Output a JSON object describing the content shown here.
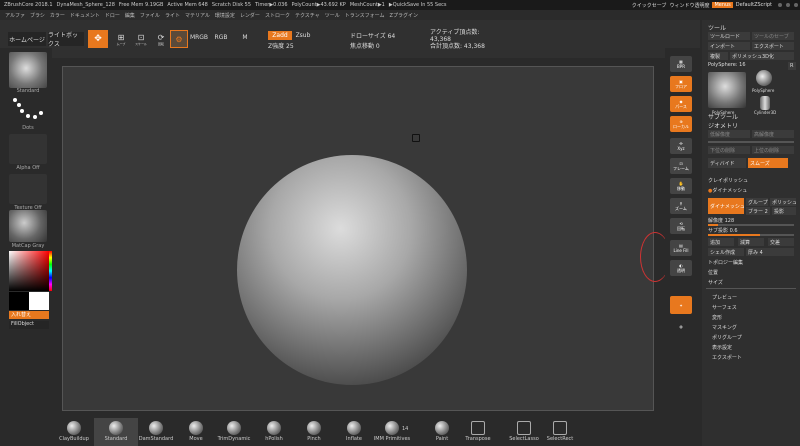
{
  "titlebar": {
    "app": "ZBrushCore 2018.1",
    "doc": "DynaMesh_Sphere_128",
    "mem": "Free Mem 9.19GB",
    "active": "Active Mem 648",
    "scratch": "Scratch Disk 55",
    "timer": "Timer▶0.036",
    "poly": "PolyCount▶43.692 KP",
    "mesh": "MeshCount▶1",
    "quick": "▶QuickSave In 55 Secs"
  },
  "topright": {
    "quicksave": "クイックセーブ",
    "transparent": "ウィンドウ透明度",
    "menus": "Menus",
    "script": "DefaultZScript"
  },
  "menubar": [
    "アルファ",
    "ブラシ",
    "カラー",
    "ドキュメント",
    "ドロー",
    "編集",
    "ファイル",
    "ライト",
    "マテリアル",
    "環境設定",
    "レンダー",
    "ストローク",
    "テクスチャ",
    "ツール",
    "トランスフォーム",
    "Zプラグイン"
  ],
  "toolbar": {
    "home": "ホームページ",
    "lightbox": "ライトボックス",
    "edit": "編集",
    "move": "ムーブ",
    "scale": "スケール",
    "rotate": "回転",
    "mrgb": "MRGB",
    "rgb": "RGB",
    "m": "M",
    "zadd": "Zadd",
    "zsub": "Zsub",
    "zintensity": "Z強度 25",
    "drawsize": "ドローサイズ 64",
    "focal": "焦点移動 0",
    "active_pts": "アクティブ頂点数: 43,368",
    "total_pts": "合計頂点数: 43,368"
  },
  "leftshelf": {
    "standard": "Standard",
    "dots": "Dots",
    "alpha": "Alpha Off",
    "texture": "Texture Off",
    "matcap": "MatCap Gray",
    "swap": "入れ替え",
    "fill": "FillObject"
  },
  "rightshelf": {
    "bpr": "BPR",
    "floor": "フロア",
    "persp": "パース",
    "local": "ローカル",
    "xyz": "Xyz",
    "frame": "フレーム",
    "move": "移動",
    "zoom": "ズーム",
    "rotate": "回転",
    "linefill": "Line Fill",
    "transp": "透明"
  },
  "panel": {
    "title": "ツール",
    "load": "ツールロード",
    "save": "ツールのセーブ",
    "import": "インポート",
    "export": "エクスポート",
    "clone": "複製",
    "polymesh": "ポリメッシュ3D化",
    "polysphere": "PolySphere: 16",
    "r": "R",
    "thumb1": "PolySphere",
    "thumb2": "PolySphere",
    "thumb3": "Cylinder3D",
    "subtool": "サブツール",
    "geometry": "ジオメトリ",
    "lower": "低解像度",
    "higher": "高解像度",
    "delLower": "下位の削除",
    "delHigher": "上位の削除",
    "divide": "ディバイド",
    "smooth": "スムーズ",
    "polish": "クレイポリッシュ",
    "dynamesh_label": "ダイナメッシュ",
    "dynamesh_btn": "ダイナメッシュ",
    "group": "グループ",
    "polish2": "ポリッシュ",
    "blur": "ブラー 2",
    "project": "投影",
    "resolution": "解像度 128",
    "subproj": "サブ投影 0.6",
    "add": "追加",
    "sub": "減算",
    "create": "交差",
    "shell": "シェル作成",
    "thickness": "厚み 4",
    "topology": "トポロジー編集",
    "position": "位置",
    "size": "サイズ",
    "preview": "プレビュー",
    "surface": "サーフェス",
    "deform": "変形",
    "masking": "マスキング",
    "polygroups": "ポリグループ",
    "display": "表示設定",
    "export2": "エクスポート"
  },
  "bottom": [
    "ClayBuildup",
    "Standard",
    "DamStandard",
    "Move",
    "TrimDynamic",
    "hPolish",
    "Pinch",
    "Inflate",
    "IMM Primitives",
    "Paint",
    "Transpose",
    "SelectLasso",
    "SelectRect"
  ],
  "bottom_count": "14",
  "colors": {
    "accent": "#e8781e"
  }
}
